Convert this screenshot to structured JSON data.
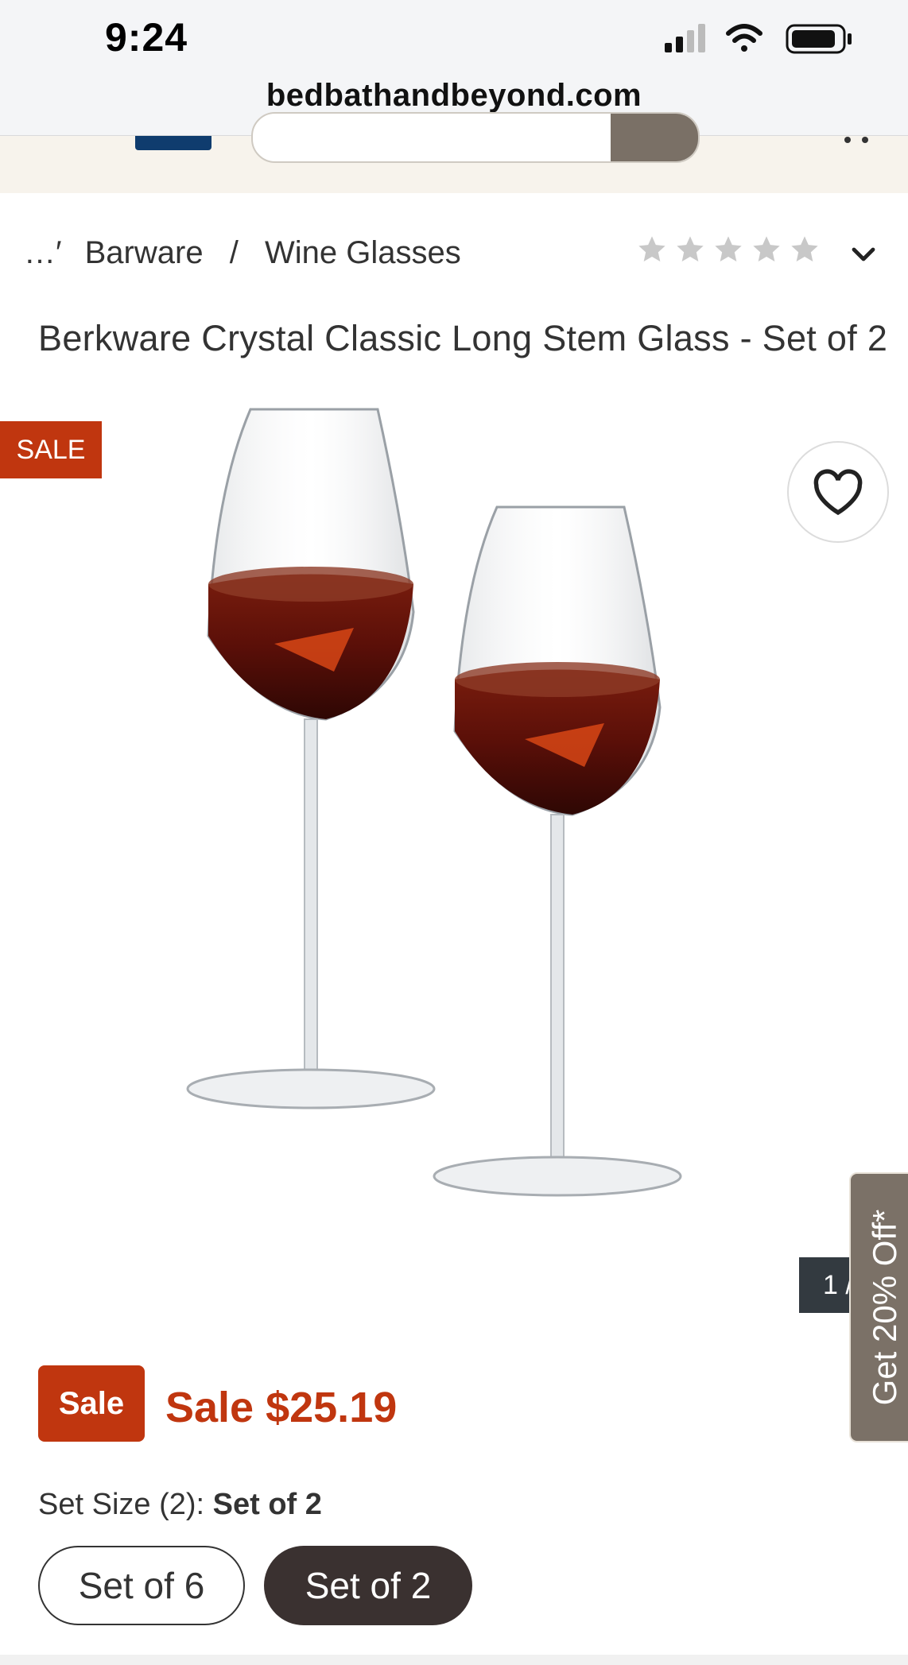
{
  "status_bar": {
    "time": "9:24",
    "url": "bedbathandbeyond.com"
  },
  "breadcrumb": {
    "ellipsis": "…′",
    "items": [
      "Barware",
      "Wine Glasses"
    ],
    "separator": "/"
  },
  "rating": {
    "stars_filled": 0,
    "stars_total": 5
  },
  "product": {
    "title": "Berkware Crystal Classic Long Stem Glass - Set of 2",
    "sale_flag": "SALE",
    "image_counter": "1 /",
    "promo_tab": "Get 20% Off*"
  },
  "price": {
    "badge": "Sale",
    "text": "Sale $25.19"
  },
  "set_size": {
    "label_prefix": "Set Size (2):",
    "selected": "Set of 2",
    "options": [
      "Set of 6",
      "Set of 2"
    ]
  },
  "colors": {
    "sale_red": "#c0360f",
    "selected_option": "#3a3130",
    "promo_tab": "#7b7167",
    "logo_blue": "#0f3c6e"
  }
}
